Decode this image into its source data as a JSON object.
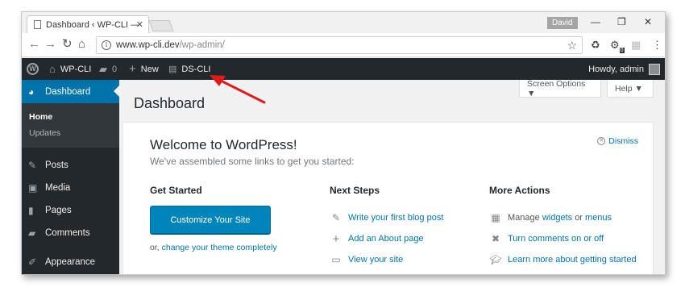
{
  "browser": {
    "tab_title": "Dashboard ‹ WP-CLI — W",
    "profile": "David",
    "url_host": "www.wp-cli.dev",
    "url_path": "/wp-admin/",
    "ext_badge": "0"
  },
  "adminbar": {
    "site": "WP-CLI",
    "comments_count": "0",
    "new": "New",
    "ds_cli": "DS-CLI",
    "howdy": "Howdy, admin"
  },
  "sidebar": {
    "dashboard": "Dashboard",
    "home": "Home",
    "updates": "Updates",
    "items": [
      "Posts",
      "Media",
      "Pages",
      "Comments",
      "Appearance"
    ]
  },
  "screen_options": "Screen Options ▼",
  "help": "Help ▼",
  "page_title": "Dashboard",
  "welcome": {
    "title": "Welcome to WordPress!",
    "about": "We've assembled some links to get you started:",
    "dismiss": "Dismiss",
    "get_started": "Get Started",
    "customize": "Customize Your Site",
    "or": "or,",
    "change_theme": "change your theme completely",
    "next_steps": "Next Steps",
    "next_links": [
      "Write your first blog post",
      "Add an About page",
      "View your site"
    ],
    "more_actions": "More Actions",
    "manage": "Manage",
    "widgets": "widgets",
    "or_word": "or",
    "menus": "menus",
    "comments_toggle": "Turn comments on or off",
    "learn_more": "Learn more about getting started"
  },
  "colors": {
    "admin_bar": "#23282d",
    "menu_highlight": "#0073aa",
    "button": "#0085ba",
    "arrow": "#e01b1b"
  }
}
